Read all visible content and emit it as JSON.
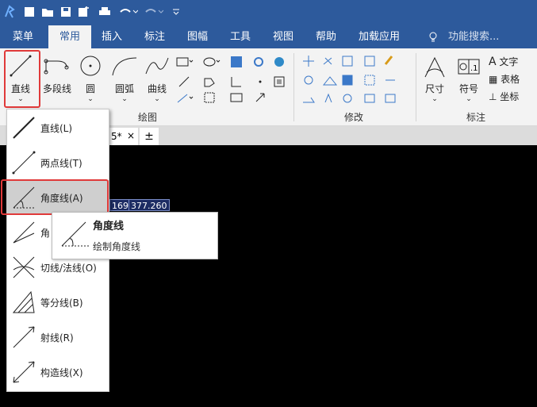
{
  "menu": {
    "tabs": [
      {
        "label": "菜单"
      },
      {
        "label": "常用"
      },
      {
        "label": "插入"
      },
      {
        "label": "标注"
      },
      {
        "label": "图幅"
      },
      {
        "label": "工具"
      },
      {
        "label": "视图"
      },
      {
        "label": "帮助"
      },
      {
        "label": "加载应用"
      }
    ],
    "search_placeholder": "功能搜索..."
  },
  "ribbon": {
    "draw": {
      "line_label": "直线",
      "polyline_label": "多段线",
      "circle_label": "圆",
      "arc_label": "圆弧",
      "curve_label": "曲线",
      "group_label": "绘图"
    },
    "modify": {
      "group_label": "修改"
    },
    "annotate": {
      "dimension_label": "尺寸",
      "symbol_label": "符号",
      "text_label": "文字",
      "table_label": "表格",
      "coordinate_label": "坐标",
      "group_label": "标注"
    }
  },
  "doc_tab": {
    "name_fragment": "5*"
  },
  "canvas": {
    "coord_x": "169",
    "coord_y": "377.260"
  },
  "dropdown": {
    "items": [
      {
        "label": "直线(L)"
      },
      {
        "label": "两点线(T)"
      },
      {
        "label": "角度线(A)"
      },
      {
        "label": "角"
      },
      {
        "label": "切线/法线(O)"
      },
      {
        "label": "等分线(B)"
      },
      {
        "label": "射线(R)"
      },
      {
        "label": "构造线(X)"
      }
    ]
  },
  "tooltip": {
    "title": "角度线",
    "description": "绘制角度线"
  },
  "colors": {
    "accent": "#2d5a9c",
    "highlight_outline": "#e03a3a"
  }
}
